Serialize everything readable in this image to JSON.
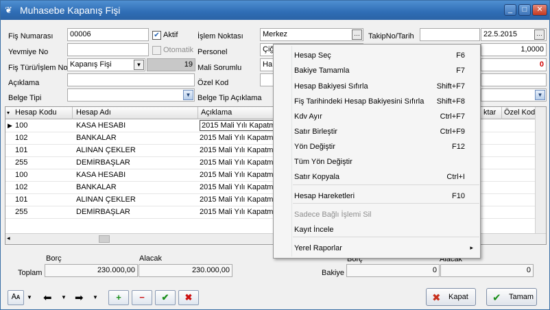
{
  "window": {
    "title": "Muhasebe Kapanış Fişi",
    "minimize": "_",
    "maximize": "□",
    "close": "✕"
  },
  "form": {
    "fis_numarasi_label": "Fiş Numarası",
    "fis_numarasi": "00006",
    "aktif_label": "Aktif",
    "aktif_checked": "✔",
    "otomatik_label": "Otomatik",
    "yevmiye_label": "Yevmiye No",
    "yevmiye": "",
    "fis_turu_label": "Fiş Türü/İşlem No",
    "fis_turu": "Kapanış Fişi",
    "islem_no": "19",
    "aciklama_label": "Açıklama",
    "aciklama": "",
    "belge_tipi_label": "Belge Tipi",
    "belge_tipi": "",
    "islem_noktasi_label": "İşlem Noktası",
    "islem_noktasi": "Merkez",
    "personel_label": "Personel",
    "personel": "Çiğ",
    "mali_sorumlu_label": "Mali Sorumlu",
    "mali_sorumlu": "Ha",
    "ozel_kod_label": "Özel Kod",
    "ozel_kod": "",
    "belge_tip_aciklama_label": "Belge Tip Açıklama",
    "takip_label": "TakipNo/Tarih",
    "takip_no": "",
    "tarih": "22.5.2015",
    "kur_value": "1,0000",
    "red_value": "0"
  },
  "grid": {
    "columns": [
      "Hesap Kodu",
      "Hesap Adı",
      "Açıklama",
      "ktar",
      "Özel Kod"
    ],
    "rows": [
      {
        "kod": "100",
        "ad": "KASA HESABI",
        "aciklama": "2015 Mali Yılı Kapatma"
      },
      {
        "kod": "102",
        "ad": "BANKALAR",
        "aciklama": "2015 Mali Yılı Kapatma"
      },
      {
        "kod": "101",
        "ad": "ALINAN ÇEKLER",
        "aciklama": "2015 Mali Yılı Kapatma"
      },
      {
        "kod": "255",
        "ad": "DEMİRBAŞLAR",
        "aciklama": "2015 Mali Yılı Kapatma"
      },
      {
        "kod": "100",
        "ad": "KASA HESABI",
        "aciklama": "2015 Mali Yılı Kapatma"
      },
      {
        "kod": "102",
        "ad": "BANKALAR",
        "aciklama": "2015 Mali Yılı Kapatma"
      },
      {
        "kod": "101",
        "ad": "ALINAN ÇEKLER",
        "aciklama": "2015 Mali Yılı Kapatma"
      },
      {
        "kod": "255",
        "ad": "DEMİRBAŞLAR",
        "aciklama": "2015 Mali Yılı Kapatma"
      }
    ]
  },
  "totals": {
    "borc_label": "Borç",
    "alacak_label": "Alacak",
    "toplam_label": "Toplam",
    "toplam_borc": "230.000,00",
    "toplam_alacak": "230.000,00",
    "bakiye_label": "Bakiye",
    "bakiye_borc": "0",
    "bakiye_alacak": "0"
  },
  "menu": [
    {
      "label": "Hesap Seç",
      "shortcut": "F6",
      "enabled": true
    },
    {
      "label": "Bakiye Tamamla",
      "shortcut": "F7",
      "enabled": true
    },
    {
      "label": "Hesap Bakiyesi Sıfırla",
      "shortcut": "Shift+F7",
      "enabled": true
    },
    {
      "label": "Fiş Tarihindeki Hesap Bakiyesini Sıfırla",
      "shortcut": "Shift+F8",
      "enabled": true
    },
    {
      "label": "Kdv Ayır",
      "shortcut": "Ctrl+F7",
      "enabled": true
    },
    {
      "label": "Satır Birleştir",
      "shortcut": "Ctrl+F9",
      "enabled": true
    },
    {
      "label": "Yön Değiştir",
      "shortcut": "F12",
      "enabled": true
    },
    {
      "label": "Tüm Yön Değiştir",
      "shortcut": "",
      "enabled": true
    },
    {
      "label": "Satır Kopyala",
      "shortcut": "Ctrl+I",
      "enabled": true
    },
    {
      "label": "Hesap Hareketleri",
      "shortcut": "F10",
      "enabled": true
    },
    {
      "label": "Sadece Bağlı İşlemi Sil",
      "shortcut": "",
      "enabled": false
    },
    {
      "label": "Kayıt İncele",
      "shortcut": "",
      "enabled": true
    },
    {
      "label": "Yerel Raporlar",
      "shortcut": "▸",
      "enabled": true
    }
  ],
  "buttons": {
    "kapat": "Kapat",
    "tamam": "Tamam"
  },
  "colors": {
    "title_bar": "#2f6db5",
    "red_value": "#d00000",
    "add": "#1a8f1a",
    "remove": "#cc1111"
  }
}
